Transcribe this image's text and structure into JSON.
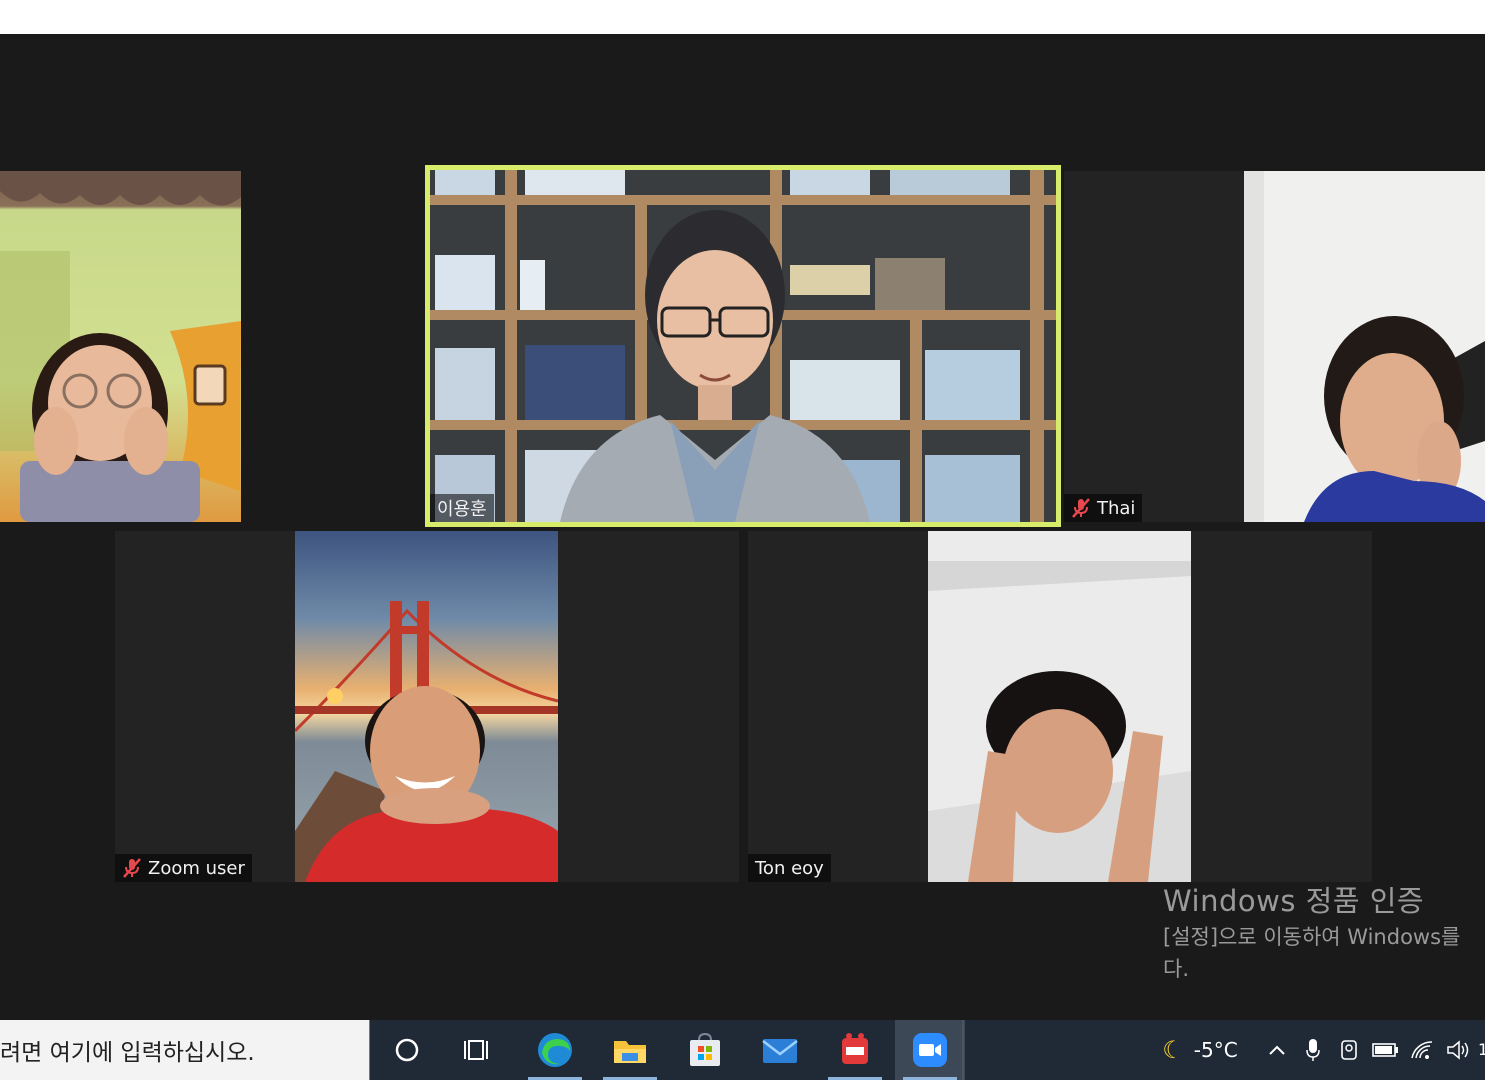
{
  "participants": [
    {
      "name": "",
      "muted": false
    },
    {
      "name": "이용훈",
      "muted": false,
      "active_speaker": true
    },
    {
      "name": "Thai",
      "muted": true
    },
    {
      "name": "Zoom user",
      "muted": true
    },
    {
      "name": "Ton eoy",
      "muted": false
    }
  ],
  "watermark": {
    "title": "Windows 정품 인증",
    "line1": "[설정]으로 이동하여 Windows를",
    "line2": "다."
  },
  "taskbar": {
    "search_placeholder": "려면 여기에 입력하십시오.",
    "apps": [
      "search-circle",
      "task-view",
      "edge",
      "file-explorer",
      "microsoft-store",
      "mail",
      "pdf-app",
      "zoom"
    ],
    "weather_temp": "-5°C"
  },
  "colors": {
    "active_speaker_border": "#d7ec6a",
    "background": "#1a1a1a",
    "taskbar": "#202a36"
  }
}
